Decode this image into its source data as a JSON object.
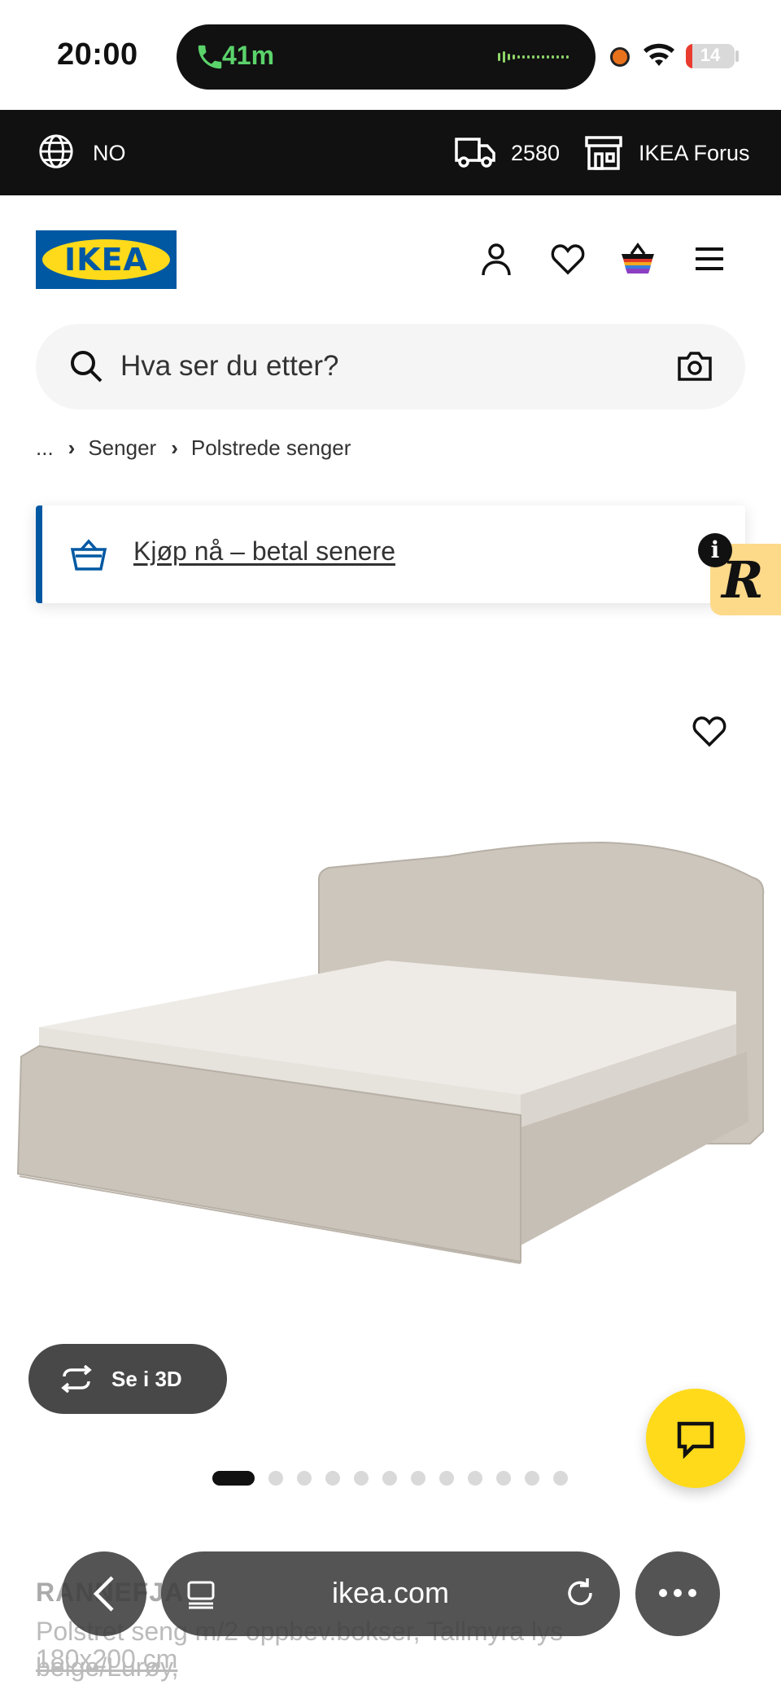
{
  "status_bar": {
    "time": "20:00",
    "call_duration": "41m",
    "battery_level": "14",
    "battery_fraction": 0.14
  },
  "top_bar": {
    "language": "NO",
    "postcode": "2580",
    "store": "IKEA Forus"
  },
  "header": {
    "logo_text": "IKEA",
    "icons": [
      "user-icon",
      "heart-icon",
      "basket-icon",
      "menu-icon"
    ]
  },
  "search": {
    "placeholder": "Hva ser du etter?"
  },
  "breadcrumb": {
    "items": [
      "...",
      "Senger",
      "Polstrede senger"
    ]
  },
  "promo": {
    "link": "Kjøp nå – betal senere",
    "badge_info": "i",
    "badge_letter": "R"
  },
  "product": {
    "view_3d_label": "Se i 3D",
    "image_count": 12,
    "active_image": 1,
    "title_visible": "RANNEFJA",
    "description_visible": "Polstret seng m/2 oppbev.bokser, Tallmyra lys beige/Lurøy,",
    "size": "180x200 cm"
  },
  "browser": {
    "url": "ikea.com"
  },
  "colors": {
    "ikea_blue": "#0058a3",
    "ikea_yellow": "#ffda1a",
    "top_bar": "#111111",
    "bed_fabric": "#cfc8be"
  }
}
